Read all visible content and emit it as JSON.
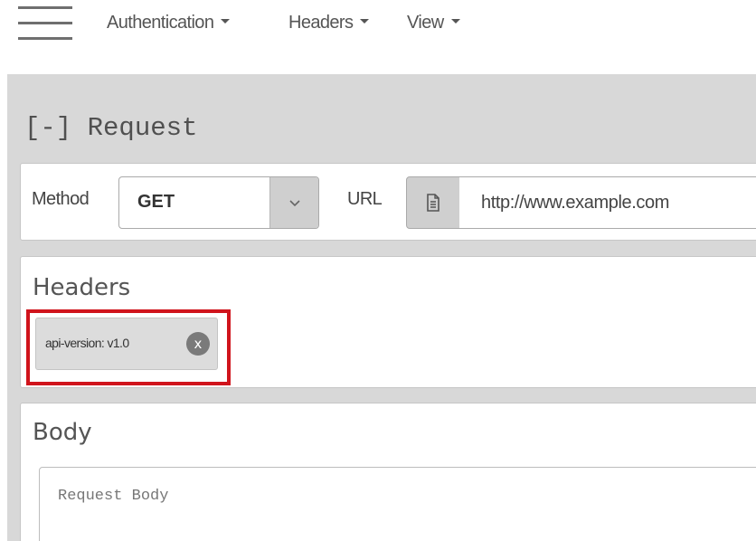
{
  "menu": {
    "hamburger_icon": "hamburger-icon",
    "items": [
      {
        "label": "Authentication"
      },
      {
        "label": "Headers"
      },
      {
        "label": "View"
      }
    ]
  },
  "request": {
    "title": "[-] Request",
    "method_label": "Method",
    "method_value": "GET",
    "url_label": "URL",
    "url_icon": "document-icon",
    "url_value": "http://www.example.com"
  },
  "headers": {
    "title": "Headers",
    "tags": [
      {
        "text": "api-version: v1.0",
        "remove_label": "x"
      }
    ],
    "highlight_color": "#d0141c"
  },
  "body": {
    "title": "Body",
    "placeholder": "Request Body"
  }
}
